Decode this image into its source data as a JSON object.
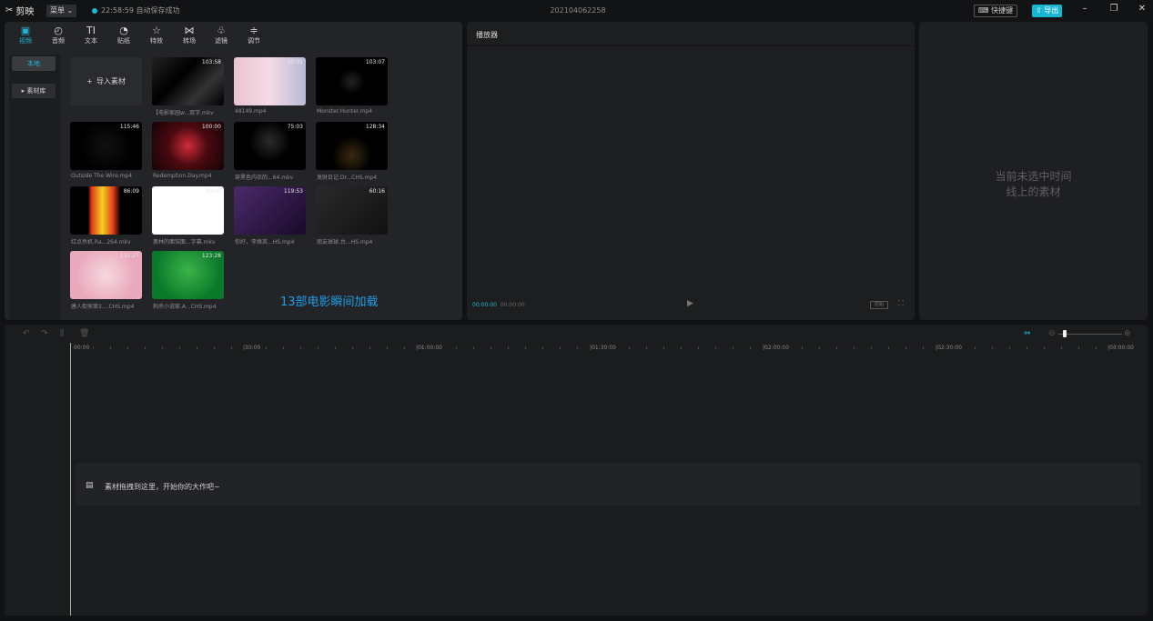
{
  "app": {
    "logo_text": "剪映",
    "menu_label": "菜单",
    "autosave_text": "22:58:59 自动保存成功",
    "project_title": "202104062258",
    "shortcut_label": "快捷键",
    "export_label": "导出"
  },
  "tabs": [
    {
      "label": "视频",
      "icon": "▣"
    },
    {
      "label": "音频",
      "icon": "◴"
    },
    {
      "label": "文本",
      "icon": "TI"
    },
    {
      "label": "贴纸",
      "icon": "◔"
    },
    {
      "label": "特效",
      "icon": "☆"
    },
    {
      "label": "转场",
      "icon": "⋈"
    },
    {
      "label": "滤镜",
      "icon": "♧"
    },
    {
      "label": "调节",
      "icon": "≑"
    }
  ],
  "sidebar": {
    "local_label": "本地",
    "library_label": "▸ 素材库"
  },
  "media": {
    "import_label": "导入素材",
    "items": [
      {
        "name": "【电影家园w...双字.mkv",
        "duration": "103:58"
      },
      {
        "name": "48149.mp4",
        "duration": "00:05"
      },
      {
        "name": "Monster.Hunter.mp4",
        "duration": "103:07"
      },
      {
        "name": "Outside The Wire.mp4",
        "duration": "115:46"
      },
      {
        "name": "Redemption.Day.mp4",
        "duration": "100:00"
      },
      {
        "name": "穿黑色内衣的...64.mkv",
        "duration": "75:03"
      },
      {
        "name": "发财日记.Dr...CHS.mp4",
        "duration": "128:34"
      },
      {
        "name": "红点杀机.Ra...264.mkv",
        "duration": "86:09"
      },
      {
        "name": "奥林的面馆面...字幕.mkv",
        "duration": "00:00"
      },
      {
        "name": "你好，李焕英...HS.mp4",
        "duration": "119:53"
      },
      {
        "name": "朋友球球.台...HS.mp4",
        "duration": "60:16"
      },
      {
        "name": "唐人街探案3....CHS.mp4",
        "duration": "132:27"
      },
      {
        "name": "刺杀小说家.A...CHS.mp4",
        "duration": "123:28"
      }
    ],
    "overlay_note": "13部电影瞬间加载"
  },
  "player": {
    "title": "播放器",
    "current_time": "00:00:00",
    "total_time": "00:00:00",
    "ratio_label": "原始"
  },
  "properties": {
    "empty_line1": "当前未选中时间",
    "empty_line2": "线上的素材"
  },
  "timeline": {
    "ruler_labels": [
      "00:00",
      "|30:00",
      "|01:00:00",
      "|01:30:00",
      "|02:00:00",
      "|02:30:00",
      "|03:00:00"
    ],
    "drop_hint": "素材拖拽到这里，开始你的大作吧~"
  },
  "colors": {
    "accent": "#1fb6d4",
    "overlay_text": "#1f9ce6"
  }
}
